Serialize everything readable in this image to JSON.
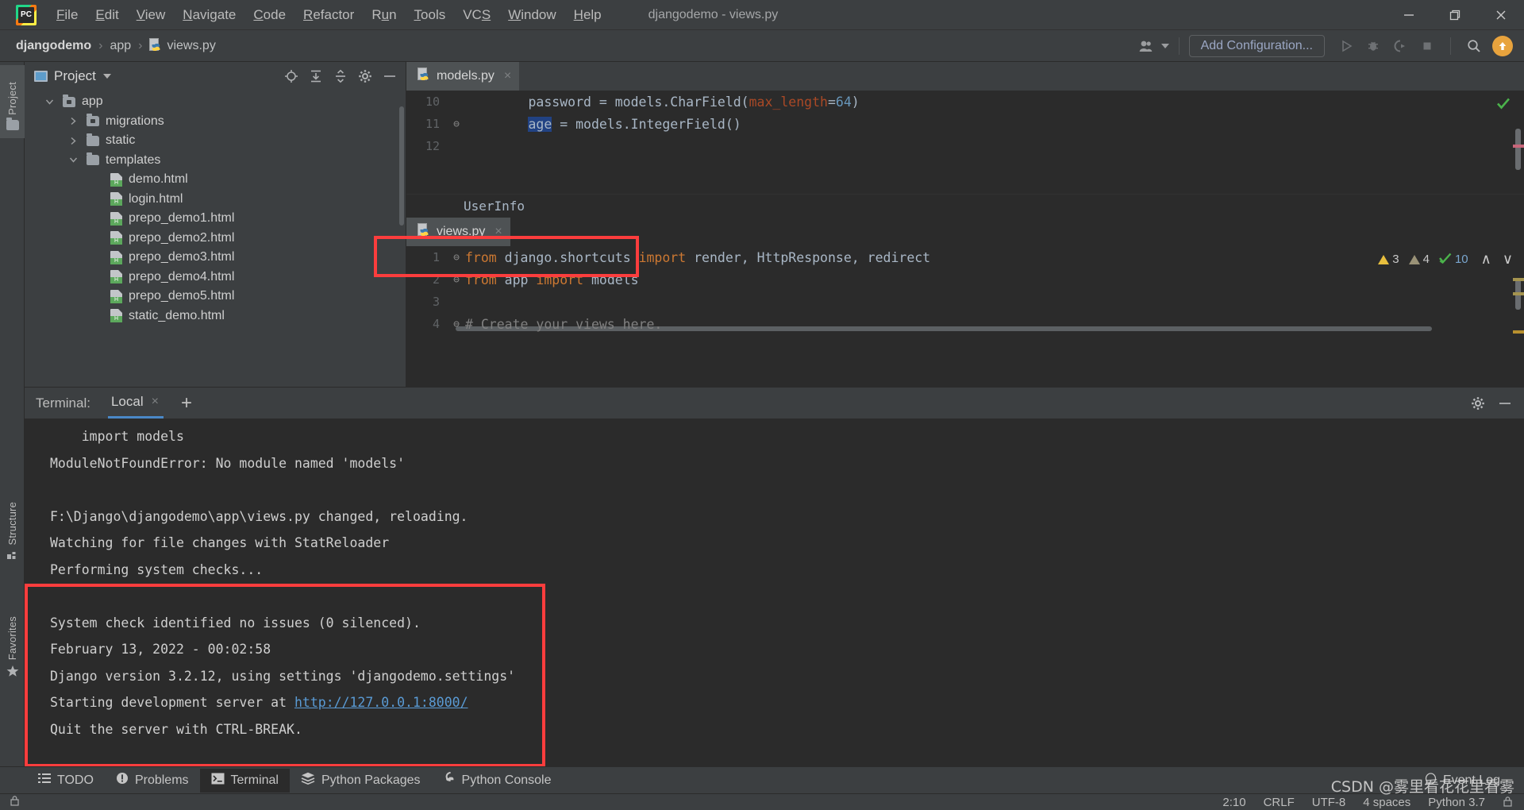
{
  "window": {
    "title": "djangodemo - views.py",
    "logo_text": "PC",
    "controls": {
      "minimize": "minimize-icon",
      "maximize": "maximize-icon",
      "close": "close-icon"
    }
  },
  "menu": [
    {
      "label": "File",
      "mnemonic": "F"
    },
    {
      "label": "Edit",
      "mnemonic": "E"
    },
    {
      "label": "View",
      "mnemonic": "V"
    },
    {
      "label": "Navigate",
      "mnemonic": "N"
    },
    {
      "label": "Code",
      "mnemonic": "C"
    },
    {
      "label": "Refactor",
      "mnemonic": "R"
    },
    {
      "label": "Run",
      "mnemonic": "u"
    },
    {
      "label": "Tools",
      "mnemonic": "T"
    },
    {
      "label": "VCS",
      "mnemonic": "S"
    },
    {
      "label": "Window",
      "mnemonic": "W"
    },
    {
      "label": "Help",
      "mnemonic": "H"
    }
  ],
  "navbar": {
    "breadcrumbs": [
      "djangodemo",
      "app",
      "views.py"
    ],
    "separator": "›",
    "add_configuration": "Add Configuration...",
    "icons": [
      "user-avatar-icon",
      "run-icon",
      "debug-icon",
      "run-coverage-icon",
      "stop-icon",
      "search-everywhere-icon",
      "update-project-icon"
    ]
  },
  "left_strip": {
    "tabs": [
      {
        "label": "Project",
        "icon": "folder-icon",
        "active": true
      },
      {
        "label": "Structure",
        "icon": "structure-icon",
        "active": false
      },
      {
        "label": "Favorites",
        "icon": "star-icon",
        "active": false
      }
    ]
  },
  "project_panel": {
    "title": "Project",
    "actions": [
      "locate-icon",
      "expand-all-icon",
      "collapse-all-icon",
      "settings-gear-icon",
      "hide-icon"
    ],
    "tree": [
      {
        "label": "app",
        "indent": 0,
        "arrow": "down",
        "icon": "module-folder-icon"
      },
      {
        "label": "migrations",
        "indent": 1,
        "arrow": "right",
        "icon": "module-folder-icon"
      },
      {
        "label": "static",
        "indent": 1,
        "arrow": "right",
        "icon": "folder-icon"
      },
      {
        "label": "templates",
        "indent": 1,
        "arrow": "down",
        "icon": "folder-icon"
      },
      {
        "label": "demo.html",
        "indent": 2,
        "arrow": "none",
        "icon": "html-file-icon"
      },
      {
        "label": "login.html",
        "indent": 2,
        "arrow": "none",
        "icon": "html-file-icon"
      },
      {
        "label": "prepo_demo1.html",
        "indent": 2,
        "arrow": "none",
        "icon": "html-file-icon"
      },
      {
        "label": "prepo_demo2.html",
        "indent": 2,
        "arrow": "none",
        "icon": "html-file-icon"
      },
      {
        "label": "prepo_demo3.html",
        "indent": 2,
        "arrow": "none",
        "icon": "html-file-icon"
      },
      {
        "label": "prepo_demo4.html",
        "indent": 2,
        "arrow": "none",
        "icon": "html-file-icon"
      },
      {
        "label": "prepo_demo5.html",
        "indent": 2,
        "arrow": "none",
        "icon": "html-file-icon"
      },
      {
        "label": "static_demo.html",
        "indent": 2,
        "arrow": "none",
        "icon": "html-file-icon"
      }
    ]
  },
  "editor_top": {
    "tab": {
      "label": "models.py",
      "icon": "python-file-icon",
      "close": "×"
    },
    "lines": [
      {
        "num": "10",
        "fold": "",
        "segments": [
          {
            "t": "        password = models.CharField(",
            "c": "plain"
          },
          {
            "t": "max_length",
            "c": "param"
          },
          {
            "t": "=",
            "c": "plain"
          },
          {
            "t": "64",
            "c": "num"
          },
          {
            "t": ")",
            "c": "plain"
          }
        ]
      },
      {
        "num": "11",
        "fold": "⊖",
        "segments": [
          {
            "t": "        ",
            "c": "plain"
          },
          {
            "t": "age",
            "c": "sel"
          },
          {
            "t": " = models.IntegerField()",
            "c": "plain"
          }
        ]
      },
      {
        "num": "12",
        "fold": "",
        "segments": [
          {
            "t": "",
            "c": "plain"
          }
        ]
      }
    ],
    "structure_path": "UserInfo",
    "check_icon": "ok-check-icon"
  },
  "editor_bottom": {
    "tab": {
      "label": "views.py",
      "icon": "python-file-icon",
      "close": "×"
    },
    "lines": [
      {
        "num": "1",
        "fold": "⊖",
        "segments": [
          {
            "t": "from",
            "c": "kw"
          },
          {
            "t": " django.shortcuts ",
            "c": "plain"
          },
          {
            "t": "import",
            "c": "kw"
          },
          {
            "t": " render, HttpResponse, redirect",
            "c": "plain"
          }
        ]
      },
      {
        "num": "2",
        "fold": "⊖",
        "segments": [
          {
            "t": "from",
            "c": "kw"
          },
          {
            "t": " app ",
            "c": "plain"
          },
          {
            "t": "import",
            "c": "kw"
          },
          {
            "t": " models",
            "c": "plain"
          }
        ]
      },
      {
        "num": "3",
        "fold": "",
        "segments": [
          {
            "t": "",
            "c": "plain"
          }
        ]
      },
      {
        "num": "4",
        "fold": "⊖",
        "segments": [
          {
            "t": "# Create your views here.",
            "c": "cmt"
          }
        ]
      }
    ],
    "inspections": {
      "warnings": "3",
      "weak_warnings": "4",
      "oks": "10",
      "up": "∧",
      "down": "∨"
    }
  },
  "terminal": {
    "label": "Terminal:",
    "tab": "Local",
    "tab_close": "×",
    "new_tab": "+",
    "actions": [
      "settings-gear-icon",
      "hide-icon"
    ],
    "lines": [
      {
        "text": "    import models",
        "link": null
      },
      {
        "text": "ModuleNotFoundError: No module named 'models'",
        "link": null
      },
      {
        "text": "",
        "link": null
      },
      {
        "text": "F:\\Django\\djangodemo\\app\\views.py changed, reloading.",
        "link": null
      },
      {
        "text": "Watching for file changes with StatReloader",
        "link": null
      },
      {
        "text": "Performing system checks...",
        "link": null
      },
      {
        "text": "",
        "link": null
      },
      {
        "text": "System check identified no issues (0 silenced).",
        "link": null
      },
      {
        "text": "February 13, 2022 - 00:02:58",
        "link": null
      },
      {
        "text": "Django version 3.2.12, using settings 'djangodemo.settings'",
        "link": null
      },
      {
        "text": "Starting development server at ",
        "link": "http://127.0.0.1:8000/"
      },
      {
        "text": "Quit the server with CTRL-BREAK.",
        "link": null
      }
    ]
  },
  "bottom_bar": {
    "items": [
      {
        "label": "TODO",
        "icon": "todo-list-icon",
        "active": false
      },
      {
        "label": "Problems",
        "icon": "problems-icon",
        "active": false
      },
      {
        "label": "Terminal",
        "icon": "terminal-icon",
        "active": true
      },
      {
        "label": "Python Packages",
        "icon": "packages-icon",
        "active": false
      },
      {
        "label": "Python Console",
        "icon": "python-console-icon",
        "active": false
      }
    ],
    "event_log": {
      "label": "Event Log",
      "icon": "event-log-icon"
    }
  },
  "status_bar": {
    "caret": "2:10",
    "line_separator": "CRLF",
    "encoding": "UTF-8",
    "indent": "4 spaces",
    "interpreter": "Python 3.7",
    "lock_icon": "lock-icon"
  },
  "watermark": "CSDN @雾里看花花里看雾",
  "colors": {
    "chrome": "#3c3f41",
    "editor_bg": "#2b2b2b",
    "accent_blue": "#4a88c7",
    "highlight_red": "#fc3d3d",
    "keyword_orange": "#cc7832",
    "number_blue": "#6897bb",
    "selection_blue": "#214283",
    "link_blue": "#5a9bd5"
  }
}
